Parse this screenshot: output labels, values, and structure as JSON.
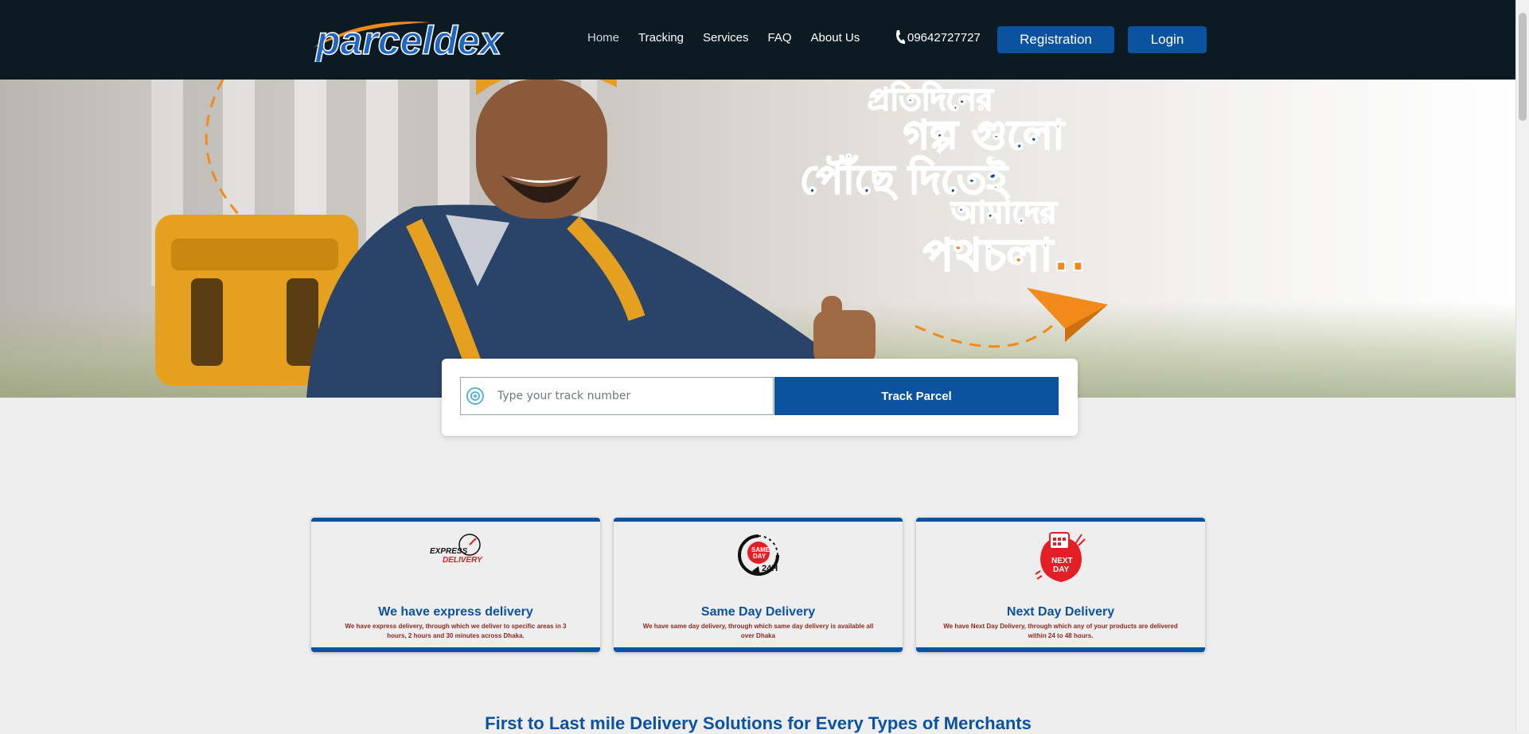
{
  "header": {
    "logo_text": "parceldex",
    "nav": [
      "Home",
      "Tracking",
      "Services",
      "FAQ",
      "About Us"
    ],
    "active_nav": "Home",
    "phone": "09642727727",
    "register_label": "Registration",
    "login_label": "Login"
  },
  "hero": {
    "slogan_lines": [
      "প্রতিদিনের",
      "গল্প গুলো",
      "পৌঁছে দিতেই",
      "আমাদের",
      "পথচলা.."
    ]
  },
  "track": {
    "placeholder": "Type your track number",
    "button_label": "Track Parcel"
  },
  "services": [
    {
      "icon_label": "EXPRESS DELIVERY",
      "title": "We have express delivery",
      "desc": "We have express delivery, through which we deliver to specific areas in 3 hours, 2 hours and 30 minutes across Dhaka."
    },
    {
      "icon_label": "SAME DAY 24H",
      "title": "Same Day Delivery",
      "desc": "We have same day delivery, through which same day delivery is available all over Dhaka"
    },
    {
      "icon_label": "NEXT DAY",
      "title": "Next Day Delivery",
      "desc": "We have Next Day Delivery, through which any of your products are delivered within 24 to 48 hours."
    }
  ],
  "section_heading": "First to Last mile Delivery Solutions for Every Types of Merchants",
  "colors": {
    "header_bg": "#0c1b23",
    "primary": "#0b52a0",
    "accent_orange": "#f18a1a",
    "desc_red": "#8b2a1f"
  }
}
